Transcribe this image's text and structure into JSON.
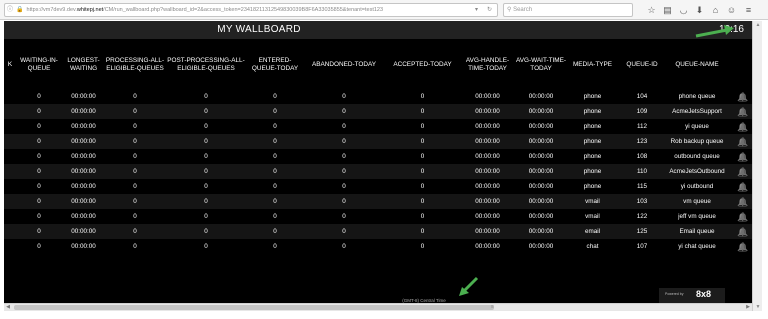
{
  "browser": {
    "url_prefix": "https://vm7dev9.dev.",
    "url_host": "whitepj.net",
    "url_suffix": "/CM/run_wallboard.php?wallboard_id=2&access_token=23418211312549830039B8F6A33035855&tenant=test123",
    "search_placeholder": "Search",
    "icons": [
      "star-icon",
      "reading-list-icon",
      "pocket-icon",
      "download-icon",
      "home-icon",
      "hello-icon",
      "menu-icon"
    ]
  },
  "wallboard": {
    "title": "MY WALLBOARD",
    "clock": "10:16",
    "columns": [
      "K",
      "WAITING-IN-QUEUE",
      "LONGEST-WAITING",
      "PROCESSING-ALL-ELIGIBLE-QUEUES",
      "POST-PROCESSING-ALL-ELIGIBLE-QUEUES",
      "ENTERED-QUEUE-TODAY",
      "ABANDONED-TODAY",
      "ACCEPTED-TODAY",
      "AVG-HANDLE-TIME-TODAY",
      "AVG-WAIT-TIME-TODAY",
      "MEDIA-TYPE",
      "QUEUE-ID",
      "QUEUE-NAME"
    ],
    "rows": [
      [
        "0",
        "00:00:00",
        "0",
        "0",
        "0",
        "0",
        "0",
        "00:00:00",
        "00:00:00",
        "phone",
        "104",
        "phone queue"
      ],
      [
        "0",
        "00:00:00",
        "0",
        "0",
        "0",
        "0",
        "0",
        "00:00:00",
        "00:00:00",
        "phone",
        "109",
        "AcmeJetsSupport"
      ],
      [
        "0",
        "00:00:00",
        "0",
        "0",
        "0",
        "0",
        "0",
        "00:00:00",
        "00:00:00",
        "phone",
        "112",
        "yi queue"
      ],
      [
        "0",
        "00:00:00",
        "0",
        "0",
        "0",
        "0",
        "0",
        "00:00:00",
        "00:00:00",
        "phone",
        "123",
        "Rob backup queue"
      ],
      [
        "0",
        "00:00:00",
        "0",
        "0",
        "0",
        "0",
        "0",
        "00:00:00",
        "00:00:00",
        "phone",
        "108",
        "outbound queue"
      ],
      [
        "0",
        "00:00:00",
        "0",
        "0",
        "0",
        "0",
        "0",
        "00:00:00",
        "00:00:00",
        "phone",
        "110",
        "AcmeJetsOutbound"
      ],
      [
        "0",
        "00:00:00",
        "0",
        "0",
        "0",
        "0",
        "0",
        "00:00:00",
        "00:00:00",
        "phone",
        "115",
        "yi outbound"
      ],
      [
        "0",
        "00:00:00",
        "0",
        "0",
        "0",
        "0",
        "0",
        "00:00:00",
        "00:00:00",
        "vmail",
        "103",
        "vm queue"
      ],
      [
        "0",
        "00:00:00",
        "0",
        "0",
        "0",
        "0",
        "0",
        "00:00:00",
        "00:00:00",
        "vmail",
        "122",
        "jeff vm queue"
      ],
      [
        "0",
        "00:00:00",
        "0",
        "0",
        "0",
        "0",
        "0",
        "00:00:00",
        "00:00:00",
        "email",
        "125",
        "Email queue"
      ],
      [
        "0",
        "00:00:00",
        "0",
        "0",
        "0",
        "0",
        "0",
        "00:00:00",
        "00:00:00",
        "chat",
        "107",
        "yi chat queue"
      ]
    ],
    "timezone": "(GMT-8) Central Time",
    "brand_powered": "Powered by",
    "brand_name": "8x8"
  },
  "colors": {
    "background": "#000000",
    "header_bar": "#222222",
    "text": "#ffffff",
    "annotation_arrow": "#4caf50"
  }
}
